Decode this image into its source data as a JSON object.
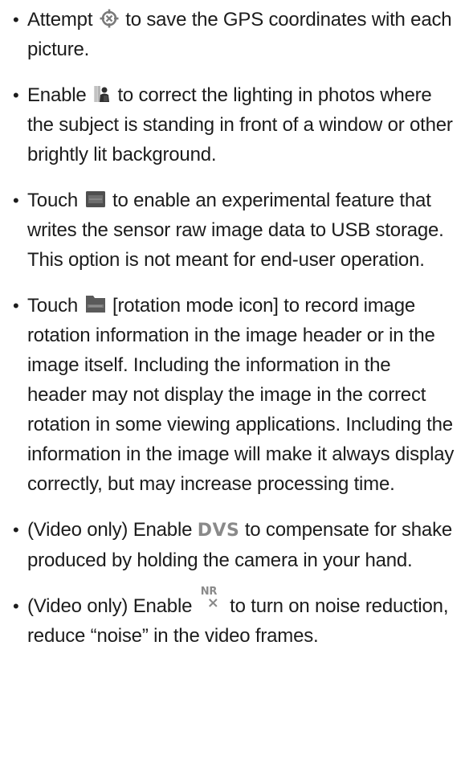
{
  "items": [
    {
      "before": "Attempt",
      "icon": "gps-crosshair-icon",
      "after": "to save the GPS coordinates with each picture."
    },
    {
      "before": "Enable",
      "icon": "backlight-person-icon",
      "after": "to correct the lighting in photos where the subject is standing in front of a window or other brightly lit background."
    },
    {
      "before": "Touch",
      "icon": "raw-image-icon",
      "after": "to enable an experimental feature that writes the sensor raw image data to USB storage. This option is not meant for end-user operation."
    },
    {
      "before": "Touch",
      "icon": "rotation-mode-icon",
      "after": "[rotation mode icon] to record image rotation information in the image header or in the image itself. Including the information in the header may not display the image in the correct rotation in some viewing applications. Including the information in the image will make it always display correctly, but may increase processing time."
    },
    {
      "before": "(Video only) Enable",
      "icon_text": "DVS",
      "after": "to compensate for shake produced by holding the camera in your hand."
    },
    {
      "before": "(Video only) Enable",
      "icon_text_top": "NR",
      "icon_text_bottom": "×",
      "after": "to turn on noise reduction, reduce “noise” in the video frames."
    }
  ]
}
